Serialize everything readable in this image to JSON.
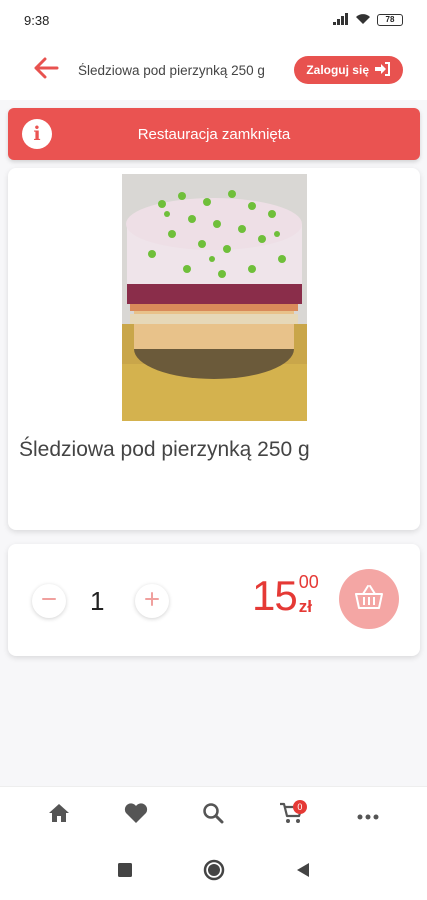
{
  "status_bar": {
    "time": "9:38",
    "battery": "78",
    "icons": [
      "signal-icon",
      "wifi-icon",
      "battery-icon"
    ]
  },
  "header": {
    "back_icon": "arrow-left-icon",
    "title": "Śledziowa pod pierzynką 250 g",
    "login_label": "Zaloguj się",
    "login_icon": "sign-in-icon"
  },
  "banner": {
    "icon": "info-icon",
    "text": "Restauracja zamknięta"
  },
  "product": {
    "image": "herring-salad-photo",
    "name": "Śledziowa pod pierzynką 250 g"
  },
  "order": {
    "quantity": "1",
    "price_integer": "15",
    "price_decimal": "00",
    "currency": "zł",
    "minus_icon": "minus-icon",
    "plus_icon": "plus-icon",
    "basket_icon": "basket-icon"
  },
  "bottom_nav": {
    "items": [
      "home-icon",
      "heart-icon",
      "search-icon",
      "cart-icon",
      "more-icon"
    ],
    "cart_count": "0"
  },
  "system_nav": [
    "square-icon",
    "circle-icon",
    "triangle-back-icon"
  ],
  "colors": {
    "accent": "#e8524f",
    "banner": "#ea5351",
    "price": "#e53935",
    "basket_button": "#f4a6a4"
  }
}
